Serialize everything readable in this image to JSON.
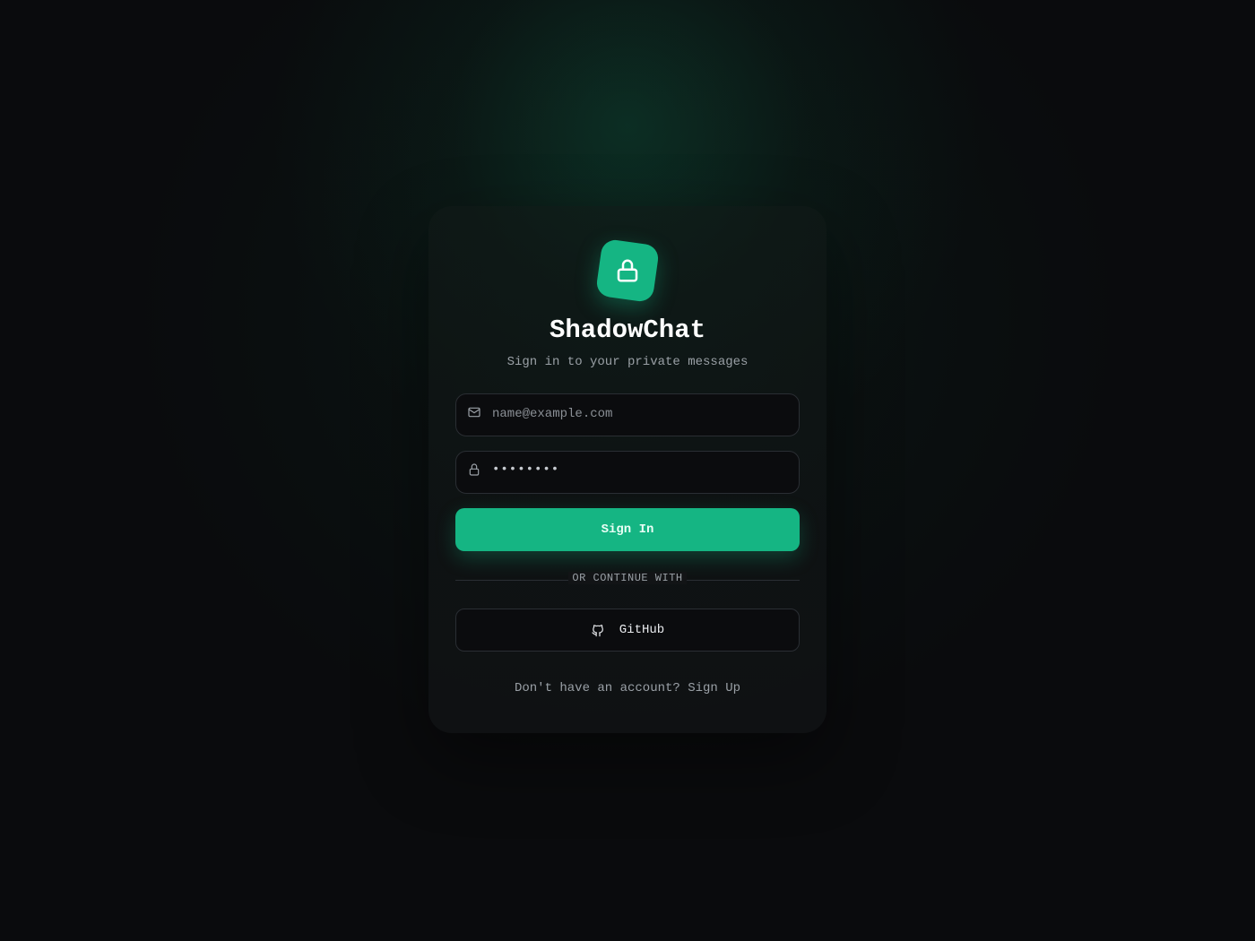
{
  "app": {
    "title": "ShadowChat",
    "subtitle": "Sign in to your private messages"
  },
  "logo": {
    "icon": "lock-icon",
    "color": "#15b583"
  },
  "form": {
    "email": {
      "placeholder": "name@example.com",
      "icon": "mail-icon"
    },
    "password": {
      "value": "••••••••",
      "icon": "lock-icon"
    },
    "submit_label": "Sign In"
  },
  "divider": {
    "label": "OR CONTINUE WITH"
  },
  "oauth": {
    "github_label": "GitHub",
    "icon": "github-icon"
  },
  "footer": {
    "prompt": "Don't have an account?",
    "link_label": "Sign Up"
  },
  "colors": {
    "accent": "#15b583",
    "background": "#0a0b0d",
    "text": "#ffffff",
    "muted": "#9aa0a6",
    "border": "#2a2e33"
  }
}
